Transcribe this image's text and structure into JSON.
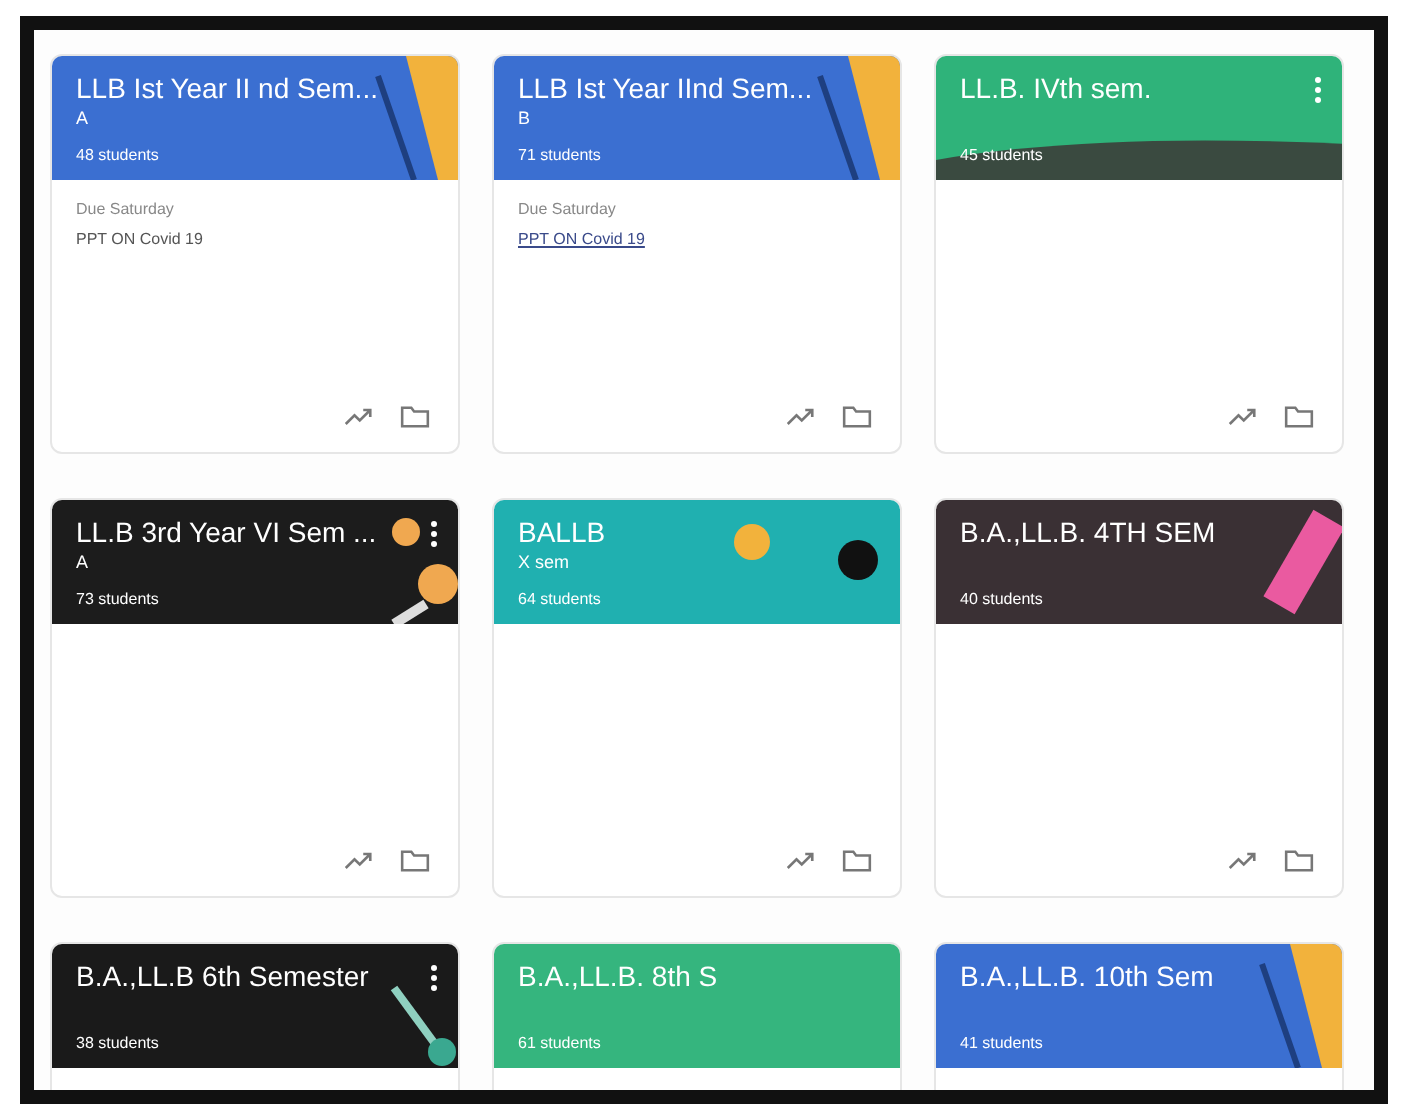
{
  "classes": [
    {
      "title": "LLB Ist Year II nd Sem...",
      "section": "A",
      "students": "48 students",
      "color": "#3b6fd1",
      "kind": "stripe",
      "menu": false,
      "due": "Due Saturday",
      "assignment": "PPT ON Covid 19",
      "link": false
    },
    {
      "title": "LLB Ist Year IInd Sem...",
      "section": "B",
      "students": "71 students",
      "color": "#3b6fd1",
      "kind": "stripe",
      "menu": false,
      "due": "Due Saturday",
      "assignment": "PPT ON Covid 19",
      "link": true
    },
    {
      "title": "LL.B. IVth sem.",
      "students": "45 students",
      "color": "#2fb37a",
      "kind": "hill",
      "menu": true
    },
    {
      "title": "LL.B 3rd Year VI Sem ...",
      "section": "A",
      "students": "73 students",
      "color": "#1c1c1c",
      "kind": "orbs",
      "menu": true
    },
    {
      "title": "BALLB",
      "section": "X sem",
      "students": "64 students",
      "color": "#20b0b0",
      "kind": "balls",
      "menu": false
    },
    {
      "title": "B.A.,LL.B. 4TH SEM",
      "students": "40 students",
      "color": "#3a3034",
      "kind": "eraser",
      "menu": false
    },
    {
      "title": "B.A.,LL.B 6th Semester",
      "students": "38 students",
      "color": "#1a1a1a",
      "kind": "pen",
      "menu": true
    },
    {
      "title": "B.A.,LL.B. 8th S",
      "students": "61 students",
      "color": "#35b57e",
      "kind": "plain",
      "menu": false
    },
    {
      "title": "B.A.,LL.B. 10th Sem",
      "students": "41 students",
      "color": "#3b6fd1",
      "kind": "stripe",
      "menu": false
    }
  ]
}
